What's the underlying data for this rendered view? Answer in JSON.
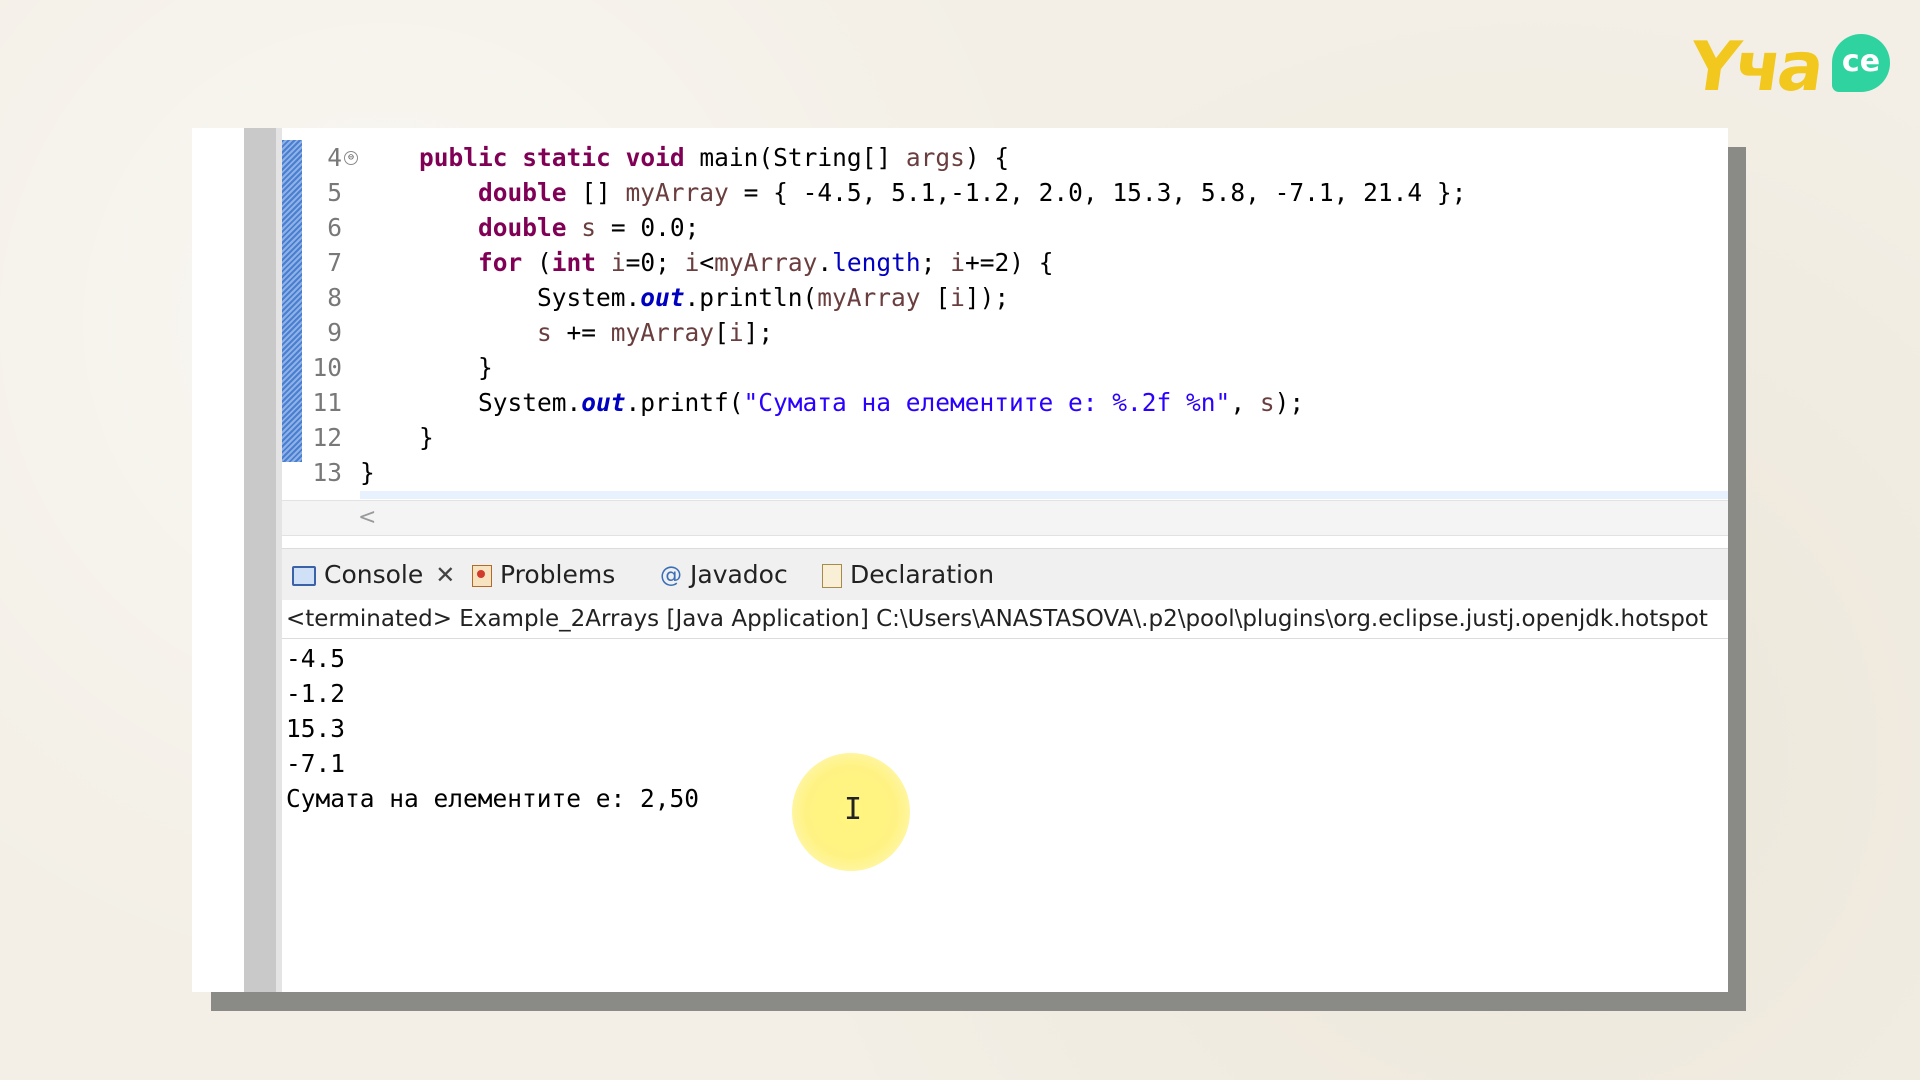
{
  "logo": {
    "text": "Yчa",
    "badge": "ce"
  },
  "editor": {
    "lines": [
      {
        "num": "4",
        "parts": [
          {
            "t": "    ",
            "c": ""
          },
          {
            "t": "public",
            "c": "kw"
          },
          {
            "t": " ",
            "c": ""
          },
          {
            "t": "static",
            "c": "kw"
          },
          {
            "t": " ",
            "c": ""
          },
          {
            "t": "void",
            "c": "kw"
          },
          {
            "t": " main(String[] ",
            "c": ""
          },
          {
            "t": "args",
            "c": "var"
          },
          {
            "t": ") {",
            "c": ""
          }
        ]
      },
      {
        "num": "5",
        "parts": [
          {
            "t": "        ",
            "c": ""
          },
          {
            "t": "double",
            "c": "kw"
          },
          {
            "t": " [] ",
            "c": ""
          },
          {
            "t": "myArray",
            "c": "var"
          },
          {
            "t": " = { -4.5, 5.1,-1.2, 2.0, 15.3, 5.8, -7.1, 21.4 };",
            "c": ""
          }
        ]
      },
      {
        "num": "6",
        "parts": [
          {
            "t": "        ",
            "c": ""
          },
          {
            "t": "double",
            "c": "kw"
          },
          {
            "t": " ",
            "c": ""
          },
          {
            "t": "s",
            "c": "var"
          },
          {
            "t": " = 0.0;",
            "c": ""
          }
        ]
      },
      {
        "num": "7",
        "parts": [
          {
            "t": "        ",
            "c": ""
          },
          {
            "t": "for",
            "c": "kw"
          },
          {
            "t": " (",
            "c": ""
          },
          {
            "t": "int",
            "c": "kw"
          },
          {
            "t": " ",
            "c": ""
          },
          {
            "t": "i",
            "c": "var"
          },
          {
            "t": "=0; ",
            "c": ""
          },
          {
            "t": "i",
            "c": "var"
          },
          {
            "t": "<",
            "c": ""
          },
          {
            "t": "myArray",
            "c": "var"
          },
          {
            "t": ".",
            "c": ""
          },
          {
            "t": "length",
            "c": "fld"
          },
          {
            "t": "; ",
            "c": ""
          },
          {
            "t": "i",
            "c": "var"
          },
          {
            "t": "+=2) {",
            "c": ""
          }
        ]
      },
      {
        "num": "8",
        "parts": [
          {
            "t": "            System.",
            "c": ""
          },
          {
            "t": "out",
            "c": "sfld"
          },
          {
            "t": ".println(",
            "c": ""
          },
          {
            "t": "myArray",
            "c": "var"
          },
          {
            "t": " [",
            "c": ""
          },
          {
            "t": "i",
            "c": "var"
          },
          {
            "t": "]);",
            "c": ""
          }
        ]
      },
      {
        "num": "9",
        "parts": [
          {
            "t": "            ",
            "c": ""
          },
          {
            "t": "s",
            "c": "var"
          },
          {
            "t": " += ",
            "c": ""
          },
          {
            "t": "myArray",
            "c": "var"
          },
          {
            "t": "[",
            "c": ""
          },
          {
            "t": "i",
            "c": "var"
          },
          {
            "t": "];",
            "c": ""
          }
        ]
      },
      {
        "num": "10",
        "parts": [
          {
            "t": "        }",
            "c": ""
          }
        ]
      },
      {
        "num": "11",
        "parts": [
          {
            "t": "        System.",
            "c": ""
          },
          {
            "t": "out",
            "c": "sfld"
          },
          {
            "t": ".printf(",
            "c": ""
          },
          {
            "t": "\"Сумата на елементите е: %.2f %n\"",
            "c": "str"
          },
          {
            "t": ", ",
            "c": ""
          },
          {
            "t": "s",
            "c": "var"
          },
          {
            "t": ");",
            "c": ""
          }
        ]
      },
      {
        "num": "12",
        "parts": [
          {
            "t": "    }",
            "c": ""
          }
        ]
      },
      {
        "num": "13",
        "parts": [
          {
            "t": "}",
            "c": ""
          }
        ]
      }
    ],
    "fold_marker": "⊖",
    "scroll_left": "<"
  },
  "console": {
    "tabs": [
      {
        "label": "Console",
        "icon": "console-icon",
        "closable": true
      },
      {
        "label": "Problems",
        "icon": "problems-icon"
      },
      {
        "label": "Javadoc",
        "icon": "javadoc-icon",
        "glyph": "@"
      },
      {
        "label": "Declaration",
        "icon": "declaration-icon"
      }
    ],
    "close_glyph": "✕",
    "header": "<terminated> Example_2Arrays [Java Application] C:\\Users\\ANASTASOVA\\.p2\\pool\\plugins\\org.eclipse.justj.openjdk.hotspot",
    "output": [
      "-4.5",
      "-1.2",
      "15.3",
      "-7.1",
      "Сумата на елементите е: 2,50"
    ],
    "cursor_glyph": "I"
  }
}
